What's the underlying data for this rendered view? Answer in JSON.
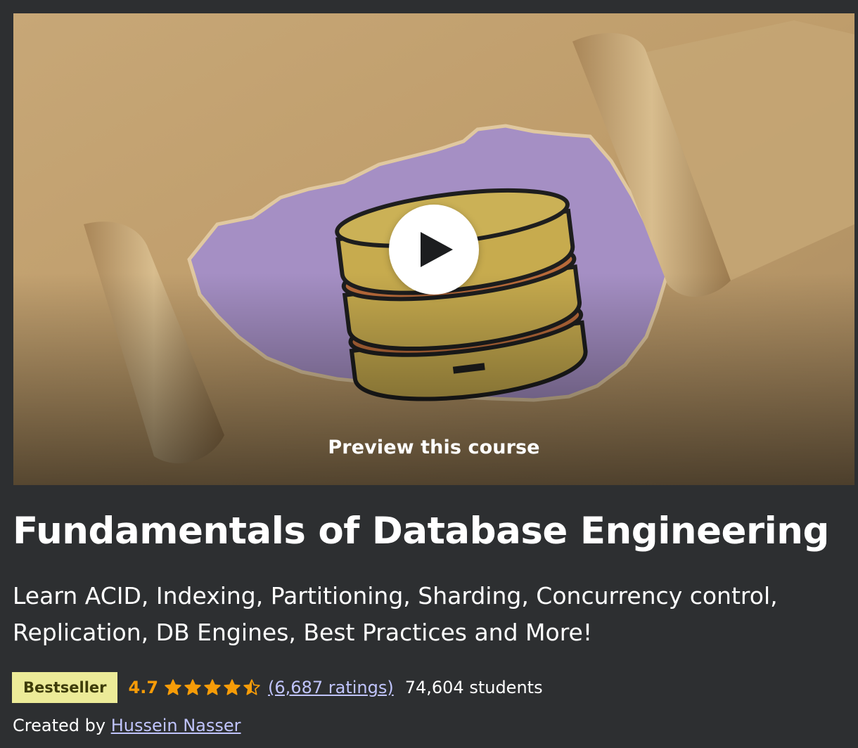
{
  "preview": {
    "label": "Preview this course",
    "icon": "play-icon"
  },
  "course": {
    "title": "Fundamentals of Database Engineering",
    "subtitle": "Learn ACID, Indexing, Partitioning, Sharding, Concurrency control, Replication, DB Engines, Best Practices and More!"
  },
  "meta": {
    "badge": "Bestseller",
    "rating": "4.7",
    "stars": 4.7,
    "ratings_count": "(6,687 ratings)",
    "students": "74,604 students"
  },
  "created": {
    "prefix": "Created by",
    "author": "Hussein Nasser"
  },
  "colors": {
    "background": "#2d2f31",
    "badge_bg": "#eceb98",
    "badge_text": "#3d3c0a",
    "rating": "#f69c08",
    "link": "#c0c4fc"
  }
}
